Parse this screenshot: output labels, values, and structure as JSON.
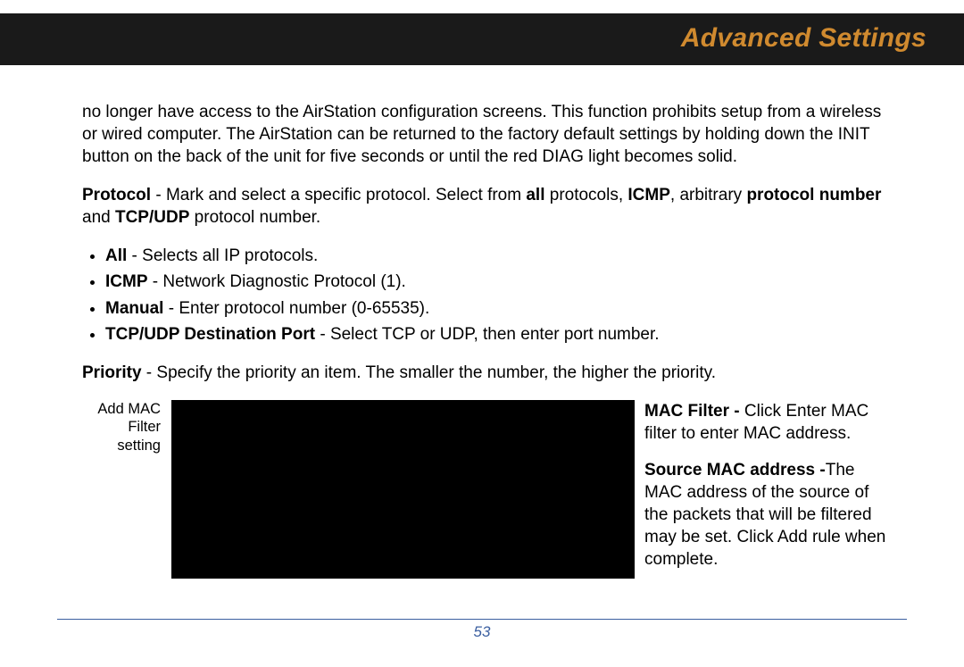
{
  "header": {
    "title": "Advanced Settings"
  },
  "intro": {
    "t1": "no longer have access to the AirStation configuration screens.  This function prohibits setup from a wireless or wired computer.  The AirStation can be returned to the factory default settings by holding down the INIT button on the back of the unit for five seconds or until the red DIAG light becomes solid."
  },
  "protocol": {
    "label": "Protocol",
    "sep": "  -  ",
    "t1": "Mark and select a specific protocol.  Select from ",
    "b1": "all",
    "t2": " protocols, ",
    "b2": "ICMP",
    "t3": ", arbitrary ",
    "b3": "protocol number",
    "t4": " and ",
    "b4": "TCP/UDP",
    "t5": " protocol number."
  },
  "bullets": [
    {
      "b": "All",
      "t": " - Selects all IP protocols."
    },
    {
      "b": "ICMP",
      "t": " - Network Diagnostic Protocol (1)."
    },
    {
      "b": "Manual",
      "t": " - Enter protocol number (0-65535)."
    },
    {
      "b": "TCP/UDP Destination Port",
      "t": " - Select TCP or UDP, then enter port number."
    }
  ],
  "priority": {
    "label": "Priority",
    "t": " - Specify the priority  an item.  The smaller the number, the higher the priority."
  },
  "caption": {
    "l1": "Add MAC",
    "l2": "Filter",
    "l3": "setting"
  },
  "side": {
    "macfilter_label": "MAC Filter - ",
    "macfilter_t": "Click Enter MAC filter to enter MAC address.",
    "srcmac_label": "Source MAC address -",
    "srcmac_t": "The MAC address of the source of the packets that will be filtered may be set. Click Add rule when complete."
  },
  "page_number": "53"
}
